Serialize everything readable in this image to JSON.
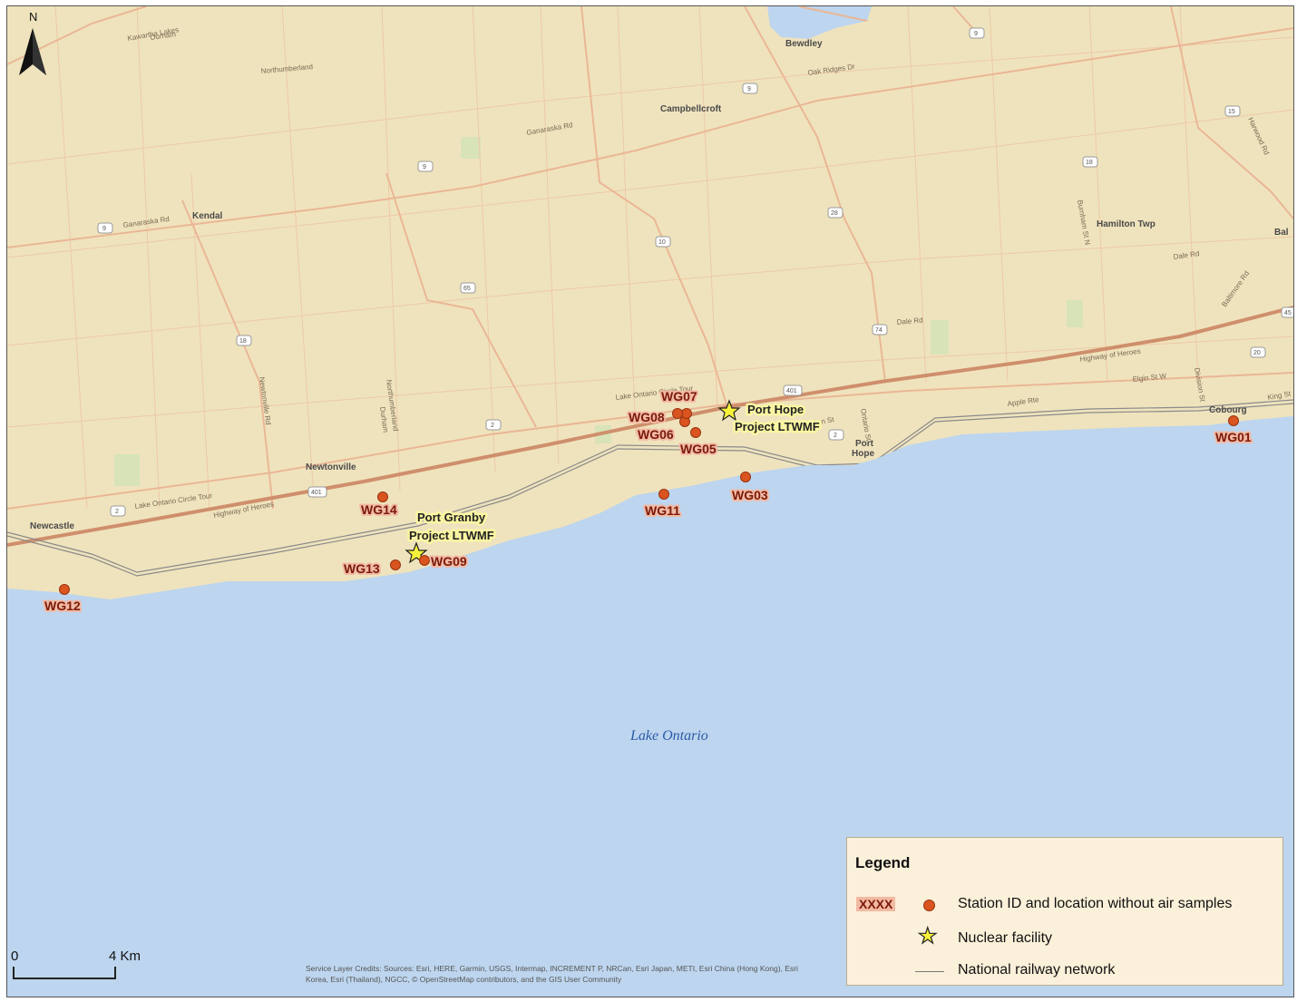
{
  "north_label": "N",
  "water_label": "Lake Ontario",
  "towns": [
    {
      "name": "Bewdley"
    },
    {
      "name": "Campbellcroft"
    },
    {
      "name": "Kendal"
    },
    {
      "name": "Hamilton Twp"
    },
    {
      "name": "Newtonville"
    },
    {
      "name": "Newcastle"
    },
    {
      "name": "Port"
    },
    {
      "name": "Hope"
    },
    {
      "name": "Cobourg"
    },
    {
      "name": "Bal"
    }
  ],
  "road_labels": [
    "Ganaraska Rd",
    "Ganaraska Rd",
    "Oak Ridges Dr",
    "Lake Ontario Circle Tour",
    "Lake Ontario Circle Tour",
    "Highway of Heroes",
    "Highway of Heroes",
    "Dale Rd",
    "Dale Rd",
    "Apple Rte",
    "Elgin St W",
    "Newtonville Rd",
    "Northumberland",
    "Durham",
    "Kawartha Lakes",
    "Durham",
    "Northumberland",
    "Walton St",
    "Ontario St",
    "Burnham St N",
    "Division St",
    "Harwood Rd",
    "Baltimore Rd",
    "King St"
  ],
  "highway_shields": [
    "9",
    "9",
    "9",
    "9",
    "10",
    "28",
    "18",
    "15",
    "18",
    "65",
    "74",
    "401",
    "401",
    "2",
    "2",
    "2",
    "20",
    "45"
  ],
  "stations": [
    {
      "id": "WG01"
    },
    {
      "id": "WG03"
    },
    {
      "id": "WG05"
    },
    {
      "id": "WG06"
    },
    {
      "id": "WG07"
    },
    {
      "id": "WG08"
    },
    {
      "id": "WG09"
    },
    {
      "id": "WG11"
    },
    {
      "id": "WG12"
    },
    {
      "id": "WG13"
    },
    {
      "id": "WG14"
    }
  ],
  "facilities": [
    {
      "line1": "Port Hope",
      "line2": "Project LTWMF"
    },
    {
      "line1": "Port Granby",
      "line2": "Project LTWMF"
    }
  ],
  "legend": {
    "title": "Legend",
    "sample_label": "XXXX",
    "station_text": "Station ID and location without air samples",
    "facility_text": "Nuclear facility",
    "railway_text": "National railway network"
  },
  "scale": {
    "start": "0",
    "end": "4 Km"
  },
  "credits": "Service Layer Credits: Sources: Esri, HERE, Garmin, USGS, Intermap, INCREMENT P, NRCan, Esri Japan, METI, Esri China (Hong Kong), Esri Korea, Esri (Thailand), NGCC, © OpenStreetMap contributors, and the GIS User Community",
  "colors": {
    "land": "#efe3bd",
    "water": "#bdd5ee",
    "road_minor": "#eec9a6",
    "highway": "#cf8f6c",
    "station_marker": "#d9541e",
    "facility_star": "#f7f23a",
    "railway": "#8a8a8a"
  }
}
